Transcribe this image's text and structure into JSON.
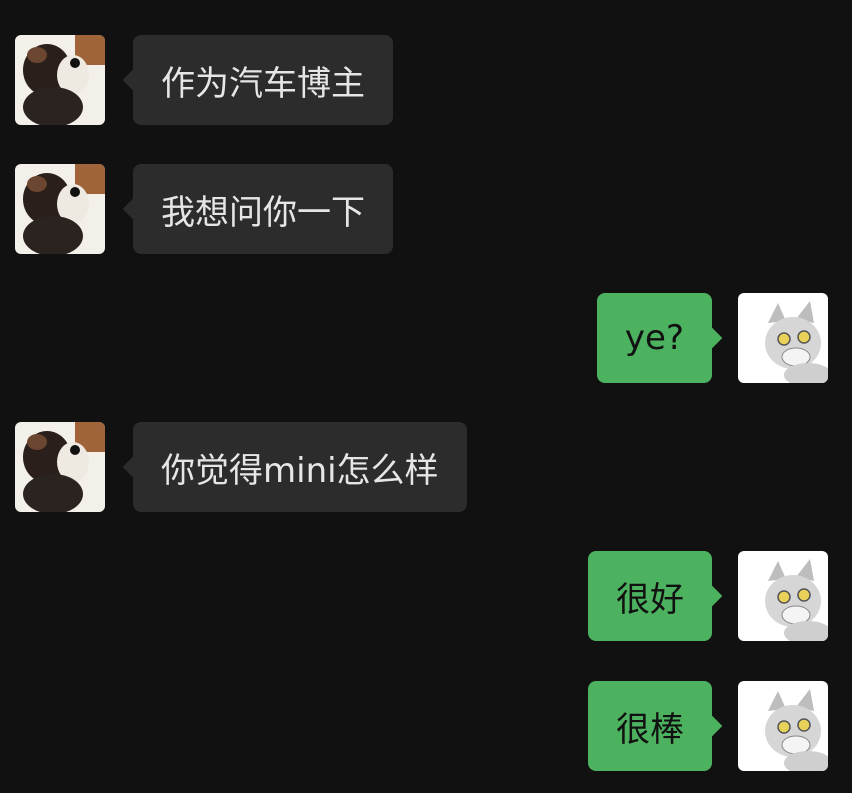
{
  "colors": {
    "background": "#111111",
    "incoming_bubble": "#2c2c2c",
    "outgoing_bubble": "#4cb25f"
  },
  "messages": [
    {
      "direction": "incoming",
      "text": "作为汽车博主",
      "avatar": "dog-avatar"
    },
    {
      "direction": "incoming",
      "text": "我想问你一下",
      "avatar": "dog-avatar"
    },
    {
      "direction": "outgoing",
      "text": "ye?",
      "avatar": "cat-avatar"
    },
    {
      "direction": "incoming",
      "text": "你觉得mini怎么样",
      "avatar": "dog-avatar"
    },
    {
      "direction": "outgoing",
      "text": "很好",
      "avatar": "cat-avatar"
    },
    {
      "direction": "outgoing",
      "text": "很棒",
      "avatar": "cat-avatar"
    }
  ]
}
